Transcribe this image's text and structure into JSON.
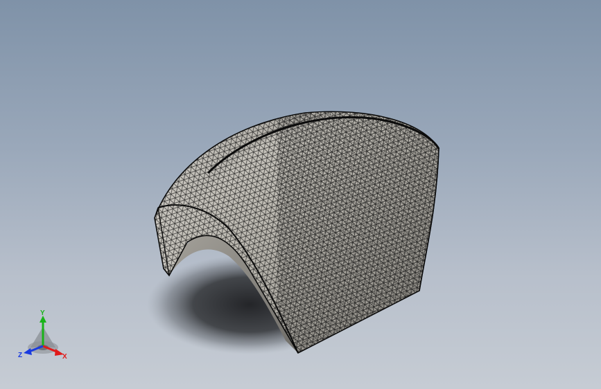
{
  "viewport": {
    "background_top": "#7f92a8",
    "background_bottom": "#c6ccd4",
    "model": {
      "display_style": "shaded-with-mesh-edges",
      "surface_color": "#bdbab2",
      "edge_color": "#101010"
    }
  },
  "triad": {
    "y_label": "Y",
    "x_label": "X",
    "z_label": "Z",
    "y_color": "#19b319",
    "x_color": "#e01a1a",
    "z_color": "#1a3be0"
  }
}
